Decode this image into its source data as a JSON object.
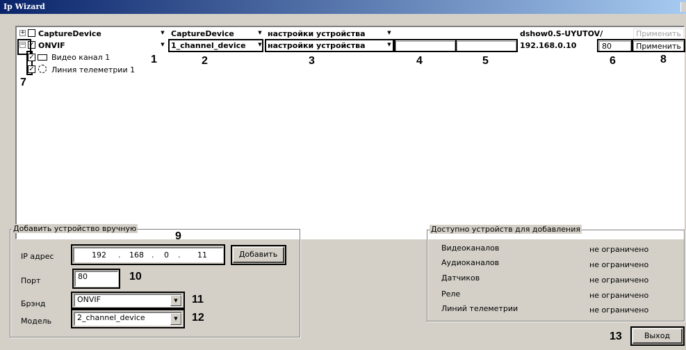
{
  "window": {
    "title": "Ip Wizard"
  },
  "grid": {
    "header_row": {
      "expander": "+",
      "checked": false,
      "device": "CaptureDevice",
      "device_type": "CaptureDevice",
      "settings": "настройки устройства",
      "col4": "",
      "col5": "",
      "address": "dshow0.S-UYUTOV/",
      "port": "",
      "apply": "Применить"
    },
    "device_row": {
      "expander": "−",
      "checked": true,
      "device": "ONVIF",
      "device_type": "1_channel_device",
      "settings": "настройки устройства",
      "col4": "",
      "col5": "",
      "address": "192.168.0.10",
      "port": "80",
      "apply": "Применить"
    },
    "children": [
      {
        "checked": true,
        "icon": "camera-icon",
        "label": "Видео канал 1"
      },
      {
        "checked": true,
        "icon": "telemetry-icon",
        "label": "Линия телеметрии 1"
      }
    ]
  },
  "annotations": {
    "n1": "1",
    "n2": "2",
    "n3": "3",
    "n4": "4",
    "n5": "5",
    "n6": "6",
    "n7": "7",
    "n8": "8",
    "n9": "9",
    "n10": "10",
    "n11": "11",
    "n12": "12",
    "n13": "13"
  },
  "manual_add": {
    "group_title": "Добавить устройство вручную",
    "ip_label": "IP адрес",
    "ip_octets": [
      "192",
      "168",
      "0",
      "11"
    ],
    "add_button": "Добавить",
    "port_label": "Порт",
    "port_value": "80",
    "brand_label": "Брэнд",
    "brand_value": "ONVIF",
    "model_label": "Модель",
    "model_value": "2_channel_device"
  },
  "available": {
    "group_title": "Доступно устройств для добавления",
    "rows": [
      {
        "label": "Видеоканалов",
        "value": "не ограничено"
      },
      {
        "label": "Аудиоканалов",
        "value": "не ограничено"
      },
      {
        "label": "Датчиков",
        "value": "не ограничено"
      },
      {
        "label": "Реле",
        "value": "не ограничено"
      },
      {
        "label": "Линий телеметрии",
        "value": "не ограничено"
      }
    ]
  },
  "exit_button": "Выход"
}
